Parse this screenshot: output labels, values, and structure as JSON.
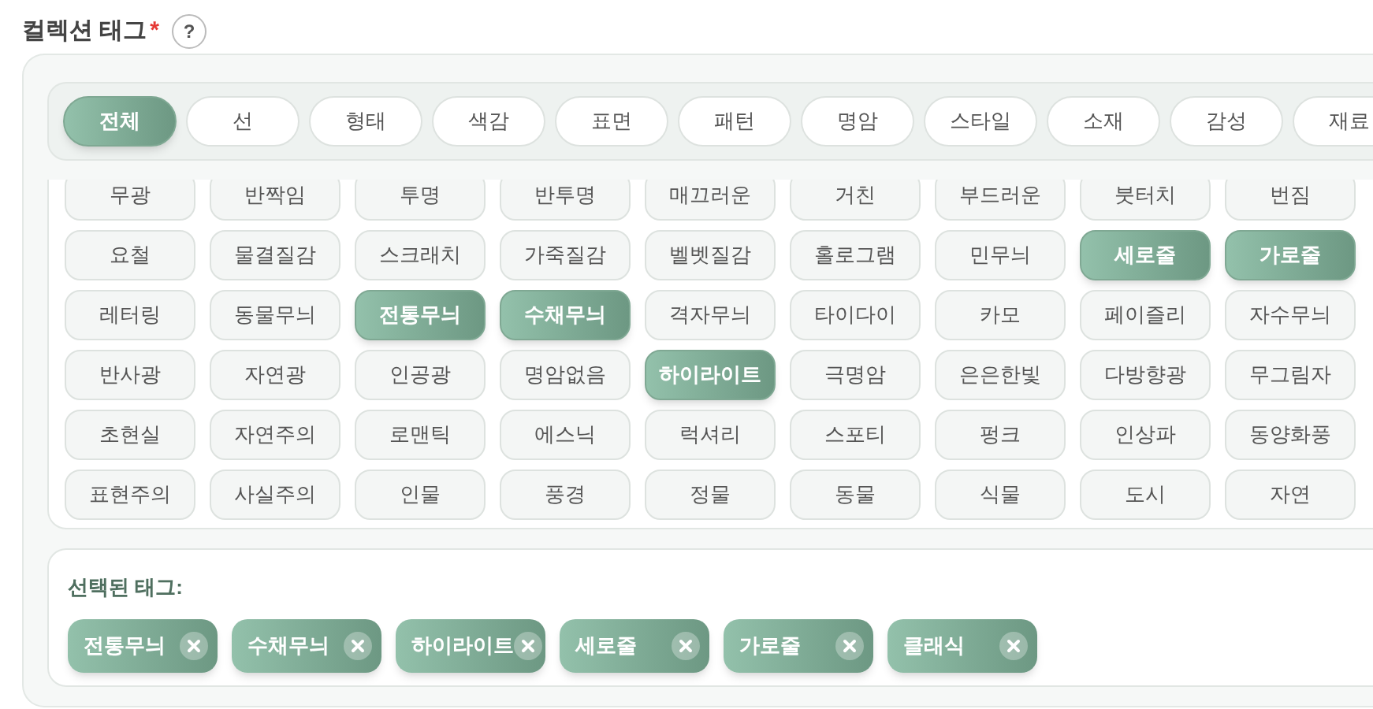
{
  "field": {
    "label": "컬렉션 태그",
    "required": true,
    "required_mark": "*",
    "help": "?"
  },
  "categories": [
    {
      "label": "전체",
      "selected": true
    },
    {
      "label": "선",
      "selected": false
    },
    {
      "label": "형태",
      "selected": false
    },
    {
      "label": "색감",
      "selected": false
    },
    {
      "label": "표면",
      "selected": false
    },
    {
      "label": "패턴",
      "selected": false
    },
    {
      "label": "명암",
      "selected": false
    },
    {
      "label": "스타일",
      "selected": false
    },
    {
      "label": "소재",
      "selected": false
    },
    {
      "label": "감성",
      "selected": false
    },
    {
      "label": "재료",
      "selected": false
    }
  ],
  "tags": [
    {
      "label": "무광",
      "selected": false
    },
    {
      "label": "반짝임",
      "selected": false
    },
    {
      "label": "투명",
      "selected": false
    },
    {
      "label": "반투명",
      "selected": false
    },
    {
      "label": "매끄러운",
      "selected": false
    },
    {
      "label": "거친",
      "selected": false
    },
    {
      "label": "부드러운",
      "selected": false
    },
    {
      "label": "붓터치",
      "selected": false
    },
    {
      "label": "번짐",
      "selected": false
    },
    {
      "label": "요철",
      "selected": false
    },
    {
      "label": "물결질감",
      "selected": false
    },
    {
      "label": "스크래치",
      "selected": false
    },
    {
      "label": "가죽질감",
      "selected": false
    },
    {
      "label": "벨벳질감",
      "selected": false
    },
    {
      "label": "홀로그램",
      "selected": false
    },
    {
      "label": "민무늬",
      "selected": false
    },
    {
      "label": "세로줄",
      "selected": true
    },
    {
      "label": "가로줄",
      "selected": true
    },
    {
      "label": "레터링",
      "selected": false
    },
    {
      "label": "동물무늬",
      "selected": false
    },
    {
      "label": "전통무늬",
      "selected": true
    },
    {
      "label": "수채무늬",
      "selected": true
    },
    {
      "label": "격자무늬",
      "selected": false
    },
    {
      "label": "타이다이",
      "selected": false
    },
    {
      "label": "카모",
      "selected": false
    },
    {
      "label": "페이즐리",
      "selected": false
    },
    {
      "label": "자수무늬",
      "selected": false
    },
    {
      "label": "반사광",
      "selected": false
    },
    {
      "label": "자연광",
      "selected": false
    },
    {
      "label": "인공광",
      "selected": false
    },
    {
      "label": "명암없음",
      "selected": false
    },
    {
      "label": "하이라이트",
      "selected": true
    },
    {
      "label": "극명암",
      "selected": false
    },
    {
      "label": "은은한빛",
      "selected": false
    },
    {
      "label": "다방향광",
      "selected": false
    },
    {
      "label": "무그림자",
      "selected": false
    },
    {
      "label": "초현실",
      "selected": false
    },
    {
      "label": "자연주의",
      "selected": false
    },
    {
      "label": "로맨틱",
      "selected": false
    },
    {
      "label": "에스닉",
      "selected": false
    },
    {
      "label": "럭셔리",
      "selected": false
    },
    {
      "label": "스포티",
      "selected": false
    },
    {
      "label": "펑크",
      "selected": false
    },
    {
      "label": "인상파",
      "selected": false
    },
    {
      "label": "동양화풍",
      "selected": false
    },
    {
      "label": "표현주의",
      "selected": false
    },
    {
      "label": "사실주의",
      "selected": false
    },
    {
      "label": "인물",
      "selected": false
    },
    {
      "label": "풍경",
      "selected": false
    },
    {
      "label": "정물",
      "selected": false
    },
    {
      "label": "동물",
      "selected": false
    },
    {
      "label": "식물",
      "selected": false
    },
    {
      "label": "도시",
      "selected": false
    },
    {
      "label": "자연",
      "selected": false
    }
  ],
  "selected_tags": {
    "title": "선택된 태그:",
    "items": [
      {
        "label": "전통무늬"
      },
      {
        "label": "수채무늬"
      },
      {
        "label": "하이라이트"
      },
      {
        "label": "세로줄"
      },
      {
        "label": "가로줄"
      },
      {
        "label": "클래식"
      }
    ]
  }
}
